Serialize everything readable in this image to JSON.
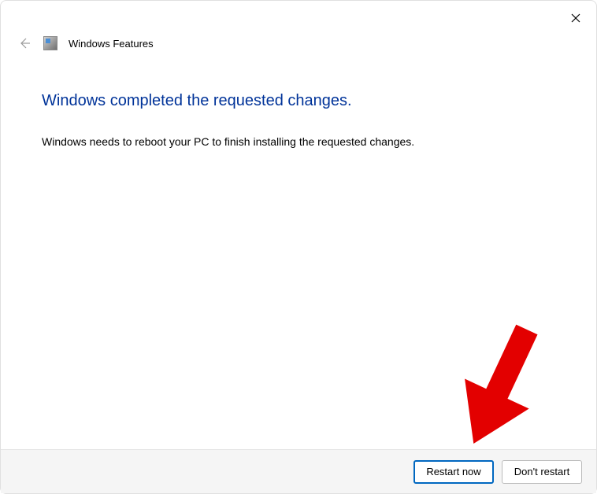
{
  "window": {
    "app_title": "Windows Features"
  },
  "content": {
    "heading": "Windows completed the requested changes.",
    "body": "Windows needs to reboot your PC to finish installing the requested changes."
  },
  "footer": {
    "primary_button": "Restart now",
    "secondary_button": "Don't restart"
  }
}
